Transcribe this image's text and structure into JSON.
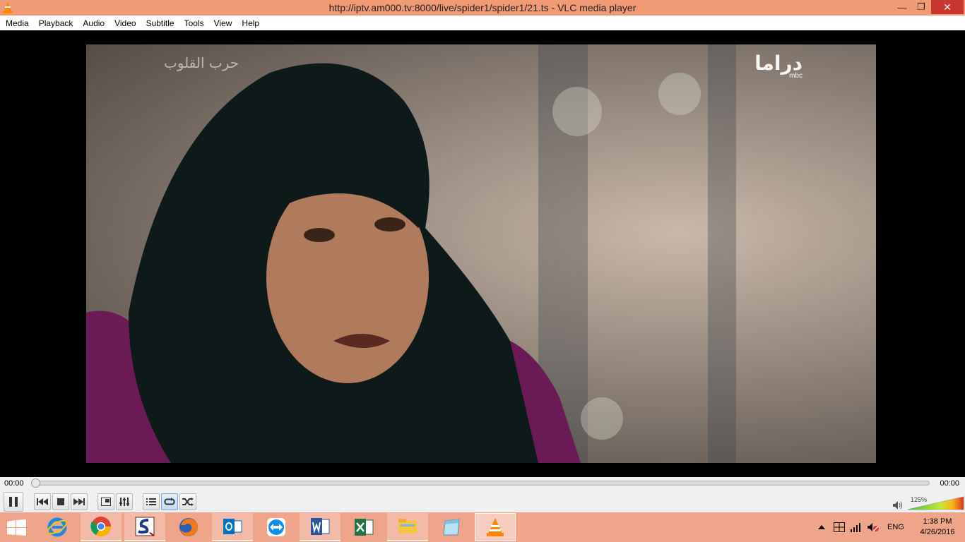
{
  "window": {
    "title": "http://iptv.am000.tv:8000/live/spider1/spider1/21.ts - VLC media player",
    "minimize_glyph": "—",
    "maximize_glyph": "❐",
    "close_glyph": "✕"
  },
  "menu": {
    "items": [
      "Media",
      "Playback",
      "Audio",
      "Video",
      "Subtitle",
      "Tools",
      "View",
      "Help"
    ]
  },
  "video": {
    "overlay_title": "حرب القلوب",
    "channel_logo": "دراما",
    "channel_sub": "mbc"
  },
  "playback": {
    "elapsed": "00:00",
    "total": "00:00",
    "progress_fraction": 0.0,
    "volume_label": "125%",
    "volume_fraction": 1.0
  },
  "controls": {
    "icons": [
      "pause-icon",
      "previous-icon",
      "stop-icon",
      "next-icon",
      "fullscreen-icon",
      "extended-settings-icon",
      "playlist-icon",
      "loop-icon",
      "shuffle-icon",
      "speaker-icon"
    ],
    "loop_active": true
  },
  "taskbar": {
    "apps": [
      "internet-explorer-icon",
      "chrome-icon",
      "app-icon",
      "firefox-icon",
      "outlook-icon",
      "teamviewer-icon",
      "word-icon",
      "excel-icon",
      "file-explorer-icon",
      "notepad-icon",
      "vlc-icon"
    ],
    "language": "ENG",
    "time": "1:38 PM",
    "date": "4/26/2016"
  },
  "colors": {
    "titlebar": "#f19a76",
    "close_button": "#c7372f",
    "taskbar": "#efa58a",
    "vlc_orange": "#ff8800"
  }
}
